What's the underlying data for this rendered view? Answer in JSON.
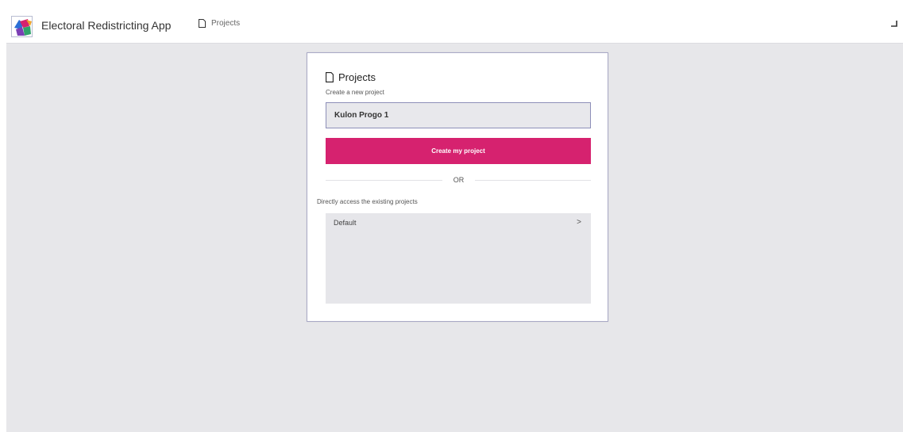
{
  "header": {
    "app_title": "Electoral Redistricting App",
    "breadcrumb_label": "Projects"
  },
  "card": {
    "title": "Projects",
    "subtitle": "Create a new project",
    "project_name_value": "Kulon Progo 1",
    "create_button_label": "Create my project",
    "divider_label": "OR",
    "existing_label": "Directly access the existing projects",
    "projects": [
      {
        "name": "Default",
        "chevron": ">"
      }
    ]
  },
  "colors": {
    "accent": "#d6226f",
    "background": "#e7e7ea",
    "card_border": "#a9a9c6"
  },
  "icons": {
    "logo": "app-logo-icon",
    "breadcrumb": "document-icon",
    "card_title": "document-icon",
    "header_right": "corner-icon"
  }
}
